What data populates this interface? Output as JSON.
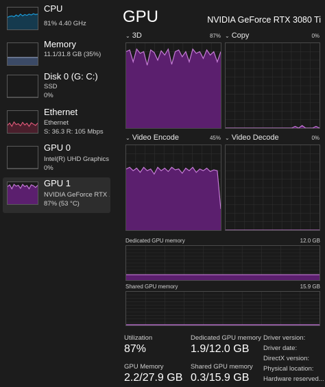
{
  "sidebar": {
    "items": [
      {
        "title": "CPU",
        "lines": [
          "81%  4.40 GHz"
        ],
        "active": false,
        "graph_color": "#1ba1e2",
        "fill_color": "#153a4e",
        "levels": [
          0.55,
          0.6,
          0.62,
          0.58,
          0.66,
          0.6,
          0.7,
          0.62,
          0.68,
          0.64,
          0.7,
          0.66,
          0.72,
          0.68,
          0.7
        ]
      },
      {
        "title": "Memory",
        "lines": [
          "11.1/31.8 GB (35%)"
        ],
        "active": false,
        "graph_color": "#8f9ebd",
        "fill_color": "#3b4a66",
        "levels": [
          0.35,
          0.35,
          0.35,
          0.35,
          0.35,
          0.35,
          0.35,
          0.35,
          0.35,
          0.35,
          0.35,
          0.35,
          0.35,
          0.35,
          0.35
        ]
      },
      {
        "title": "Disk 0 (G: C:)",
        "lines": [
          "SSD",
          "0%"
        ],
        "active": false,
        "graph_color": "#5a5a5a",
        "fill_color": "#1a1a1a",
        "levels": [
          0,
          0,
          0,
          0,
          0,
          0,
          0,
          0,
          0,
          0,
          0,
          0,
          0,
          0,
          0
        ]
      },
      {
        "title": "Ethernet",
        "lines": [
          "Ethernet",
          "S: 36.3  R: 105 Mbps"
        ],
        "active": false,
        "graph_color": "#e05a7a",
        "fill_color": "#4a1f2c",
        "levels": [
          0.35,
          0.45,
          0.3,
          0.5,
          0.38,
          0.42,
          0.32,
          0.48,
          0.36,
          0.44,
          0.3,
          0.46,
          0.4,
          0.34,
          0.45
        ]
      },
      {
        "title": "GPU 0",
        "lines": [
          "Intel(R) UHD Graphics ...",
          "0%"
        ],
        "active": false,
        "graph_color": "#5a5a5a",
        "fill_color": "#1a1a1a",
        "levels": [
          0,
          0,
          0,
          0,
          0,
          0,
          0,
          0,
          0,
          0,
          0,
          0,
          0,
          0,
          0
        ]
      },
      {
        "title": "GPU 1",
        "lines": [
          "NVIDIA GeForce RTX ...",
          "87% (53 °C)"
        ],
        "active": true,
        "graph_color": "#c77dd8",
        "fill_color": "#5b1f6e",
        "levels": [
          0.8,
          0.88,
          0.7,
          0.9,
          0.82,
          0.86,
          0.72,
          0.9,
          0.8,
          0.85,
          0.7,
          0.88,
          0.84,
          0.76,
          0.86
        ]
      }
    ]
  },
  "header": {
    "title": "GPU",
    "model": "NVIDIA GeForce RTX 3080 Ti"
  },
  "panels": [
    {
      "label": "3D",
      "percent": "87%",
      "levels": [
        0.9,
        0.92,
        0.78,
        0.93,
        0.88,
        0.9,
        0.74,
        0.92,
        0.89,
        0.8,
        0.91,
        0.86,
        0.93,
        0.75,
        0.9,
        0.92,
        0.84,
        0.9,
        0.78,
        0.93,
        0.88,
        0.9,
        0.82,
        0.92,
        0.86,
        0.9,
        0.78,
        0.9
      ]
    },
    {
      "label": "Copy",
      "percent": "0%",
      "levels": [
        0,
        0,
        0,
        0,
        0,
        0,
        0,
        0,
        0,
        0,
        0,
        0,
        0,
        0,
        0,
        0,
        0,
        0,
        0,
        0,
        0.02,
        0,
        0.03,
        0,
        0,
        0,
        0.02,
        0
      ]
    },
    {
      "label": "Video Encode",
      "percent": "45%",
      "levels": [
        0.72,
        0.74,
        0.7,
        0.73,
        0.68,
        0.74,
        0.7,
        0.72,
        0.66,
        0.74,
        0.7,
        0.73,
        0.69,
        0.74,
        0.71,
        0.72,
        0.67,
        0.73,
        0.7,
        0.74,
        0.68,
        0.72,
        0.7,
        0.73,
        0.69,
        0.71,
        0.7,
        0.25
      ]
    },
    {
      "label": "Video Decode",
      "percent": "0%",
      "levels": [
        0,
        0,
        0,
        0,
        0,
        0,
        0,
        0,
        0,
        0,
        0,
        0,
        0,
        0,
        0,
        0,
        0,
        0,
        0,
        0,
        0,
        0,
        0,
        0,
        0,
        0,
        0,
        0
      ]
    }
  ],
  "dedicated_memory": {
    "label": "Dedicated GPU memory",
    "max": "12.0 GB",
    "level": 0.158
  },
  "shared_memory": {
    "label": "Shared GPU memory",
    "max": "15.9 GB",
    "level": 0.019
  },
  "stats": {
    "utilization": {
      "label": "Utilization",
      "value": "87%"
    },
    "dedicated": {
      "label": "Dedicated GPU memory",
      "value": "1.9/12.0 GB"
    },
    "gpu_memory": {
      "label": "GPU Memory",
      "value": "2.2/27.9 GB"
    },
    "shared": {
      "label": "Shared GPU memory",
      "value": "0.3/15.9 GB"
    }
  },
  "info_labels": [
    "Driver version:",
    "Driver date:",
    "DirectX version:",
    "Physical location:",
    "Hardware reserved..."
  ],
  "colors": {
    "gpu_line": "#c77dd8",
    "gpu_fill": "#5b1f6e",
    "grid": "#2f2f2f"
  }
}
